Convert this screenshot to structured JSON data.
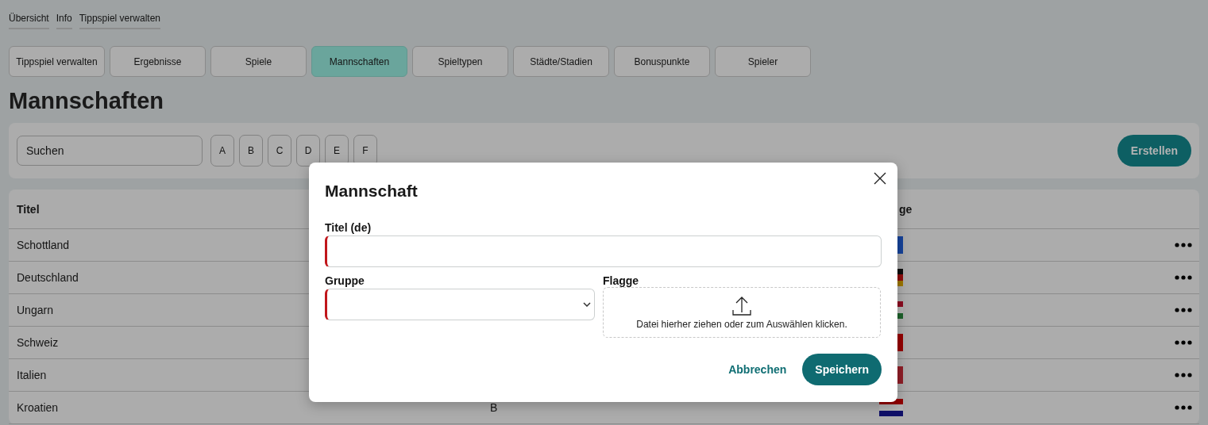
{
  "breadcrumbs": [
    {
      "label": "Übersicht"
    },
    {
      "label": "Info"
    },
    {
      "label": "Tippspiel verwalten"
    }
  ],
  "tabs": [
    {
      "label": "Tippspiel verwalten",
      "selected": false
    },
    {
      "label": "Ergebnisse",
      "selected": false
    },
    {
      "label": "Spiele",
      "selected": false
    },
    {
      "label": "Mannschaften",
      "selected": true
    },
    {
      "label": "Spieltypen",
      "selected": false
    },
    {
      "label": "Städte/Stadien",
      "selected": false
    },
    {
      "label": "Bonuspunkte",
      "selected": false
    },
    {
      "label": "Spieler",
      "selected": false
    }
  ],
  "heading": "Mannschaften",
  "toolbar": {
    "search": {
      "placeholder": "Suchen"
    },
    "letters": [
      "A",
      "B",
      "C",
      "D",
      "E",
      "F"
    ],
    "create_button": "Erstellen"
  },
  "table": {
    "title_header": "Titel",
    "flag_header": "ge",
    "rows": [
      {
        "title": "Schottland",
        "flag_stripes": [
          {
            "color": "#16439a"
          }
        ]
      },
      {
        "title": "Deutschland",
        "flag_stripes": [
          {
            "color": "#0c0c0c"
          },
          {
            "color": "#8f0c0c"
          },
          {
            "color": "#9c7600"
          }
        ]
      },
      {
        "title": "Ungarn",
        "flag_stripes": [
          {
            "color": "#8c0b20"
          },
          {
            "color": "#b3b3b3"
          },
          {
            "color": "#1d612b"
          }
        ]
      },
      {
        "title": "Schweiz",
        "flag_stripes": [
          {
            "color": "#950000"
          }
        ]
      },
      {
        "title": "Italien",
        "flag_stripes": [
          {
            "color": "#901e27"
          }
        ]
      },
      {
        "title": "Kroatien",
        "group": "B",
        "flag_stripes": [
          {
            "color": "#920000"
          },
          {
            "color": "#b3b3b3"
          },
          {
            "color": "#101069"
          }
        ]
      }
    ]
  },
  "modal": {
    "title": "Mannschaft",
    "title_field": {
      "label": "Titel (de)",
      "required": true
    },
    "group_field": {
      "label": "Gruppe",
      "required": true
    },
    "flag_upload": {
      "label": "Flagge",
      "hint": "Datei hierher ziehen oder zum Auswählen klicken."
    },
    "cancel_button": "Abbrechen",
    "save_button": "Speichern"
  }
}
